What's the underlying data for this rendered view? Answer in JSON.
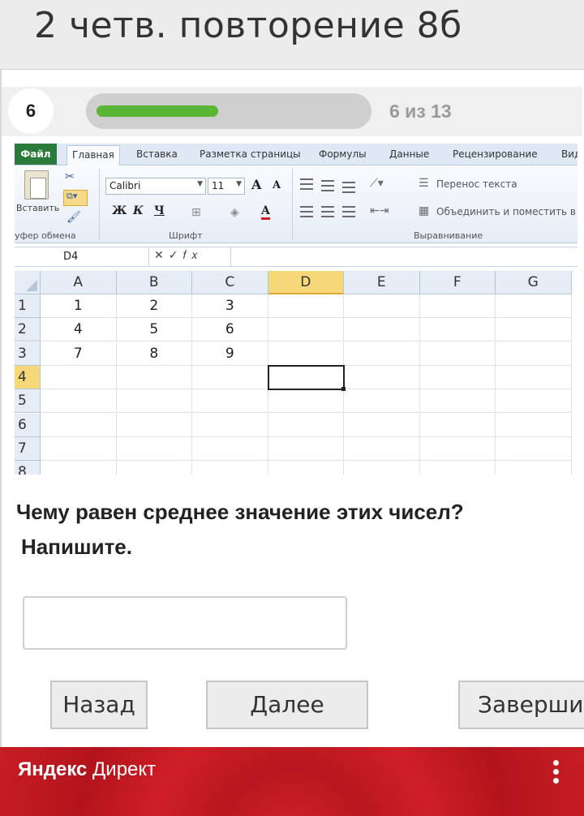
{
  "header": {
    "title": "2 четв. повторение 8б"
  },
  "progress": {
    "current_number": "6",
    "counter_text": "6 из 13",
    "fraction": 0.46,
    "fill_color": "#5bb534"
  },
  "excel": {
    "tabs": [
      "Файл",
      "Главная",
      "Вставка",
      "Разметка страницы",
      "Формулы",
      "Данные",
      "Рецензирование",
      "Вид"
    ],
    "ribbon": {
      "paste_label": "Вставить",
      "clipboard_group": "уфер обмена",
      "font_name": "Calibri",
      "font_size": "11",
      "bold": "Ж",
      "italic": "К",
      "underline": "Ч",
      "grow_font": "A",
      "shrink_font": "A",
      "font_color_letter": "A",
      "font_group": "Шрифт",
      "wrap_text": "Перенос текста",
      "merge_center": "Объединить и поместить в ц",
      "alignment_group": "Выравнивание"
    },
    "formula_bar": {
      "name_box": "D4",
      "buttons": "✕✓𝑓𝑥"
    },
    "columns": [
      "A",
      "B",
      "C",
      "D",
      "E",
      "F",
      "G"
    ],
    "rows": [
      "1",
      "2",
      "3",
      "4",
      "5",
      "6",
      "7",
      "8"
    ],
    "cells": [
      [
        "1",
        "2",
        "3"
      ],
      [
        "4",
        "5",
        "6"
      ],
      [
        "7",
        "8",
        "9"
      ]
    ],
    "selected_cell": "D4"
  },
  "question": {
    "line1": "Чему равен среднее значение этих чисел?",
    "line2": "Напишите."
  },
  "answer": {
    "value": "",
    "placeholder": ""
  },
  "buttons": {
    "back": "Назад",
    "next": "Далее",
    "finish": "Завершить"
  },
  "ad": {
    "brand_bold": "Яндекс",
    "brand_rest": " Директ"
  },
  "colors": {
    "ad_red": "#c81d25",
    "excel_file_tab": "#2a7a3b",
    "selected_header": "#f6d878"
  }
}
